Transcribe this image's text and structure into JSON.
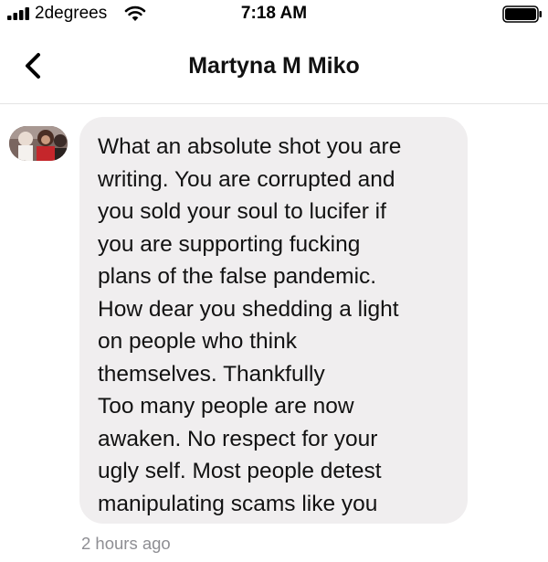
{
  "status_bar": {
    "carrier": "2degrees",
    "time": "7:18 AM",
    "signal_bars": 4,
    "battery_level": 1.0
  },
  "header": {
    "title": "Martyna M Miko"
  },
  "message": {
    "text": "What an absolute shot you are\nwriting. You are corrupted and\nyou sold your soul to lucifer if\nyou are supporting fucking\nplans of the false pandemic.\nHow dear you shedding a light\non people who think\nthemselves. Thankfully\n Too many people are now\nawaken. No respect for your\nugly self. Most people detest\nmanipulating scams like you",
    "timestamp": "2 hours ago"
  },
  "icons": {
    "back": "chevron-left-icon",
    "signal": "signal-bars-icon",
    "wifi": "wifi-icon",
    "battery": "battery-icon"
  },
  "colors": {
    "bubble": "#f0eeef",
    "timestamp": "#8e8e93"
  }
}
